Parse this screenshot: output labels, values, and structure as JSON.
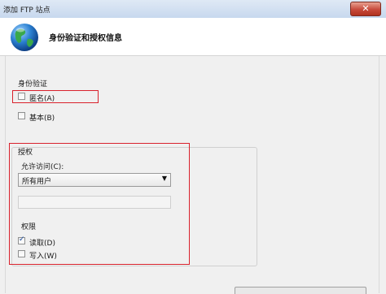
{
  "window": {
    "title": "添加 FTP 站点",
    "close_glyph": "✕"
  },
  "header": {
    "title": "身份验证和授权信息"
  },
  "authentication": {
    "label": "身份验证",
    "anonymous": {
      "label": "匿名(A)",
      "checked": false
    },
    "basic": {
      "label": "基本(B)",
      "checked": false
    }
  },
  "authorization": {
    "label": "授权",
    "allow_access_label": "允许访问(C):",
    "allow_access_value": "所有用户",
    "dropdown_arrow": "▼",
    "permissions_label": "权限",
    "read": {
      "label": "读取(D)",
      "checked": true,
      "mark": "✓"
    },
    "write": {
      "label": "写入(W)",
      "checked": false
    }
  },
  "icons": {
    "header": "globe-icon",
    "close": "close-icon"
  },
  "colors": {
    "highlight_box": "#d9212c",
    "check": "#1a4a9c"
  }
}
